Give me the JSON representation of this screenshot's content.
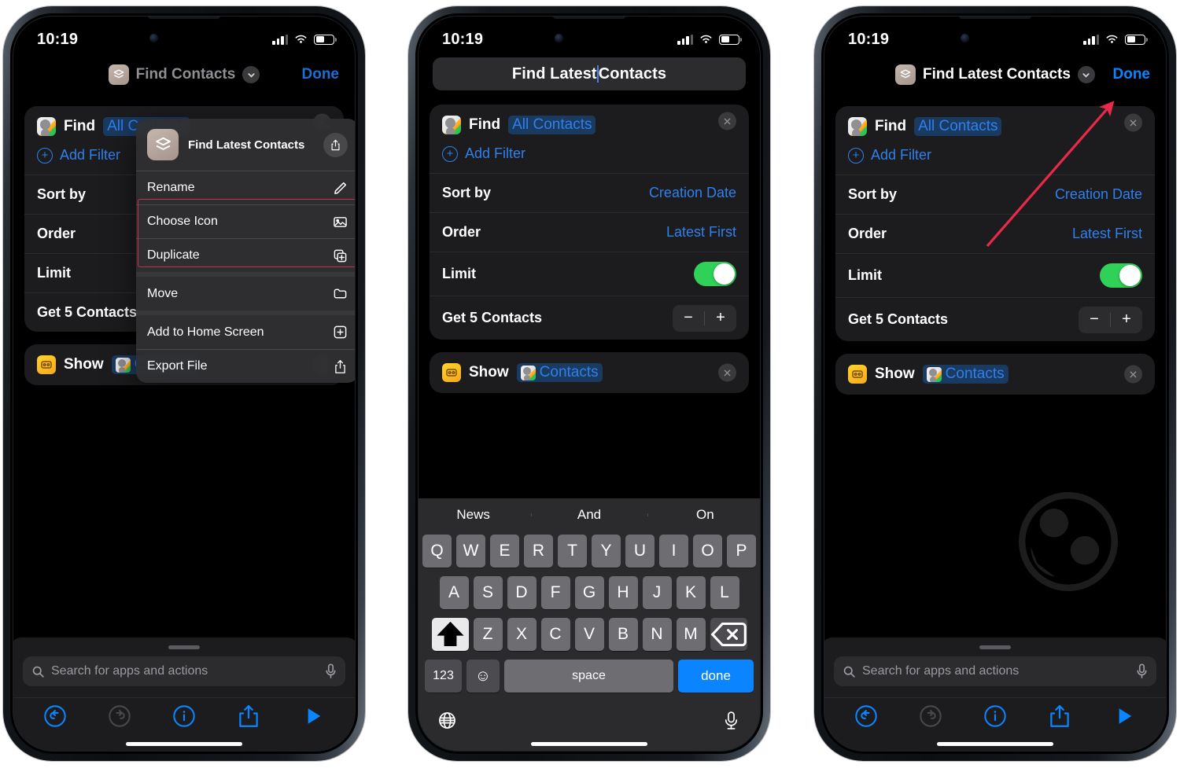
{
  "status": {
    "time": "10:19"
  },
  "phone1": {
    "nav": {
      "title": "Find Contacts",
      "done": "Done",
      "icon": "shortcuts-icon",
      "chevron": "chevron-down-icon"
    },
    "card1": {
      "action": "Find",
      "token": "All Contacts",
      "add_filter": "Add Filter",
      "rows": [
        {
          "key": "Sort by",
          "value": ""
        },
        {
          "key": "Order",
          "value": ""
        },
        {
          "key": "Limit",
          "value": ""
        },
        {
          "key": "Get 5 Contacts",
          "value": ""
        }
      ]
    },
    "card2": {
      "action": "Show",
      "token": "Contacts"
    },
    "search": {
      "placeholder": "Search for apps and actions",
      "icon": "search-icon",
      "mic_icon": "microphone-icon"
    },
    "toolbar": {
      "undo": "undo-icon",
      "redo": "redo-icon",
      "info": "info-icon",
      "share": "share-icon",
      "play": "play-icon"
    },
    "context_menu": {
      "title": "Find Latest Contacts",
      "share_icon": "share-icon",
      "items": [
        {
          "label": "Rename",
          "icon": "pencil-icon",
          "highlighted": true
        },
        {
          "label": "Choose Icon",
          "icon": "photo-icon",
          "highlighted": true
        },
        {
          "label": "Duplicate",
          "icon": "duplicate-icon",
          "highlighted": false
        },
        {
          "label": "Move",
          "icon": "folder-icon",
          "highlighted": false
        },
        {
          "label": "Add to Home Screen",
          "icon": "plus-square-icon",
          "highlighted": false
        },
        {
          "label": "Export File",
          "icon": "share-icon",
          "highlighted": false
        }
      ],
      "highlight_color": "#c0334a"
    }
  },
  "phone2": {
    "title_field": {
      "before_caret": "Find Latest",
      "after_caret": "Contacts",
      "full_value": "Find Latest Contacts"
    },
    "card1": {
      "action": "Find",
      "token": "All Contacts",
      "add_filter": "Add Filter",
      "rows": [
        {
          "key": "Sort by",
          "value": "Creation Date",
          "type": "value"
        },
        {
          "key": "Order",
          "value": "Latest First",
          "type": "value"
        },
        {
          "key": "Limit",
          "value": "on",
          "type": "toggle"
        },
        {
          "key": "Get 5 Contacts",
          "value": "",
          "type": "stepper"
        }
      ]
    },
    "card2": {
      "action": "Show",
      "token": "Contacts"
    },
    "keyboard": {
      "predictions": [
        "News",
        "And",
        "On"
      ],
      "row1": [
        "Q",
        "W",
        "E",
        "R",
        "T",
        "Y",
        "U",
        "I",
        "O",
        "P"
      ],
      "row2": [
        "A",
        "S",
        "D",
        "F",
        "G",
        "H",
        "J",
        "K",
        "L"
      ],
      "row3": [
        "Z",
        "X",
        "C",
        "V",
        "B",
        "N",
        "M"
      ],
      "shift": "shift-icon",
      "backspace": "backspace-icon",
      "numbers": "123",
      "emoji": "emoji-icon",
      "space": "space",
      "done": "done",
      "globe": "globe-icon",
      "dictation": "microphone-icon"
    }
  },
  "phone3": {
    "nav": {
      "title": "Find Latest Contacts",
      "done": "Done",
      "icon": "shortcuts-icon",
      "chevron": "chevron-down-icon"
    },
    "card1": {
      "action": "Find",
      "token": "All Contacts",
      "add_filter": "Add Filter",
      "rows": [
        {
          "key": "Sort by",
          "value": "Creation Date",
          "type": "value"
        },
        {
          "key": "Order",
          "value": "Latest First",
          "type": "value"
        },
        {
          "key": "Limit",
          "value": "on",
          "type": "toggle"
        },
        {
          "key": "Get 5 Contacts",
          "value": "",
          "type": "stepper"
        }
      ]
    },
    "card2": {
      "action": "Show",
      "token": "Contacts"
    },
    "search": {
      "placeholder": "Search for apps and actions",
      "icon": "search-icon",
      "mic_icon": "microphone-icon"
    },
    "toolbar": {
      "undo": "undo-icon",
      "redo": "redo-icon",
      "info": "info-icon",
      "share": "share-icon",
      "play": "play-icon"
    },
    "annotation": {
      "type": "arrow",
      "color": "#e8294a",
      "points_to": "Done"
    }
  },
  "colors": {
    "accent_blue": "#0b84ff",
    "link_blue": "#2f80ed",
    "toggle_green": "#30d158",
    "annotation_red": "#e8294a",
    "highlight_red": "#c0334a",
    "card_bg": "#1c1c1e",
    "menu_bg": "#303032"
  }
}
